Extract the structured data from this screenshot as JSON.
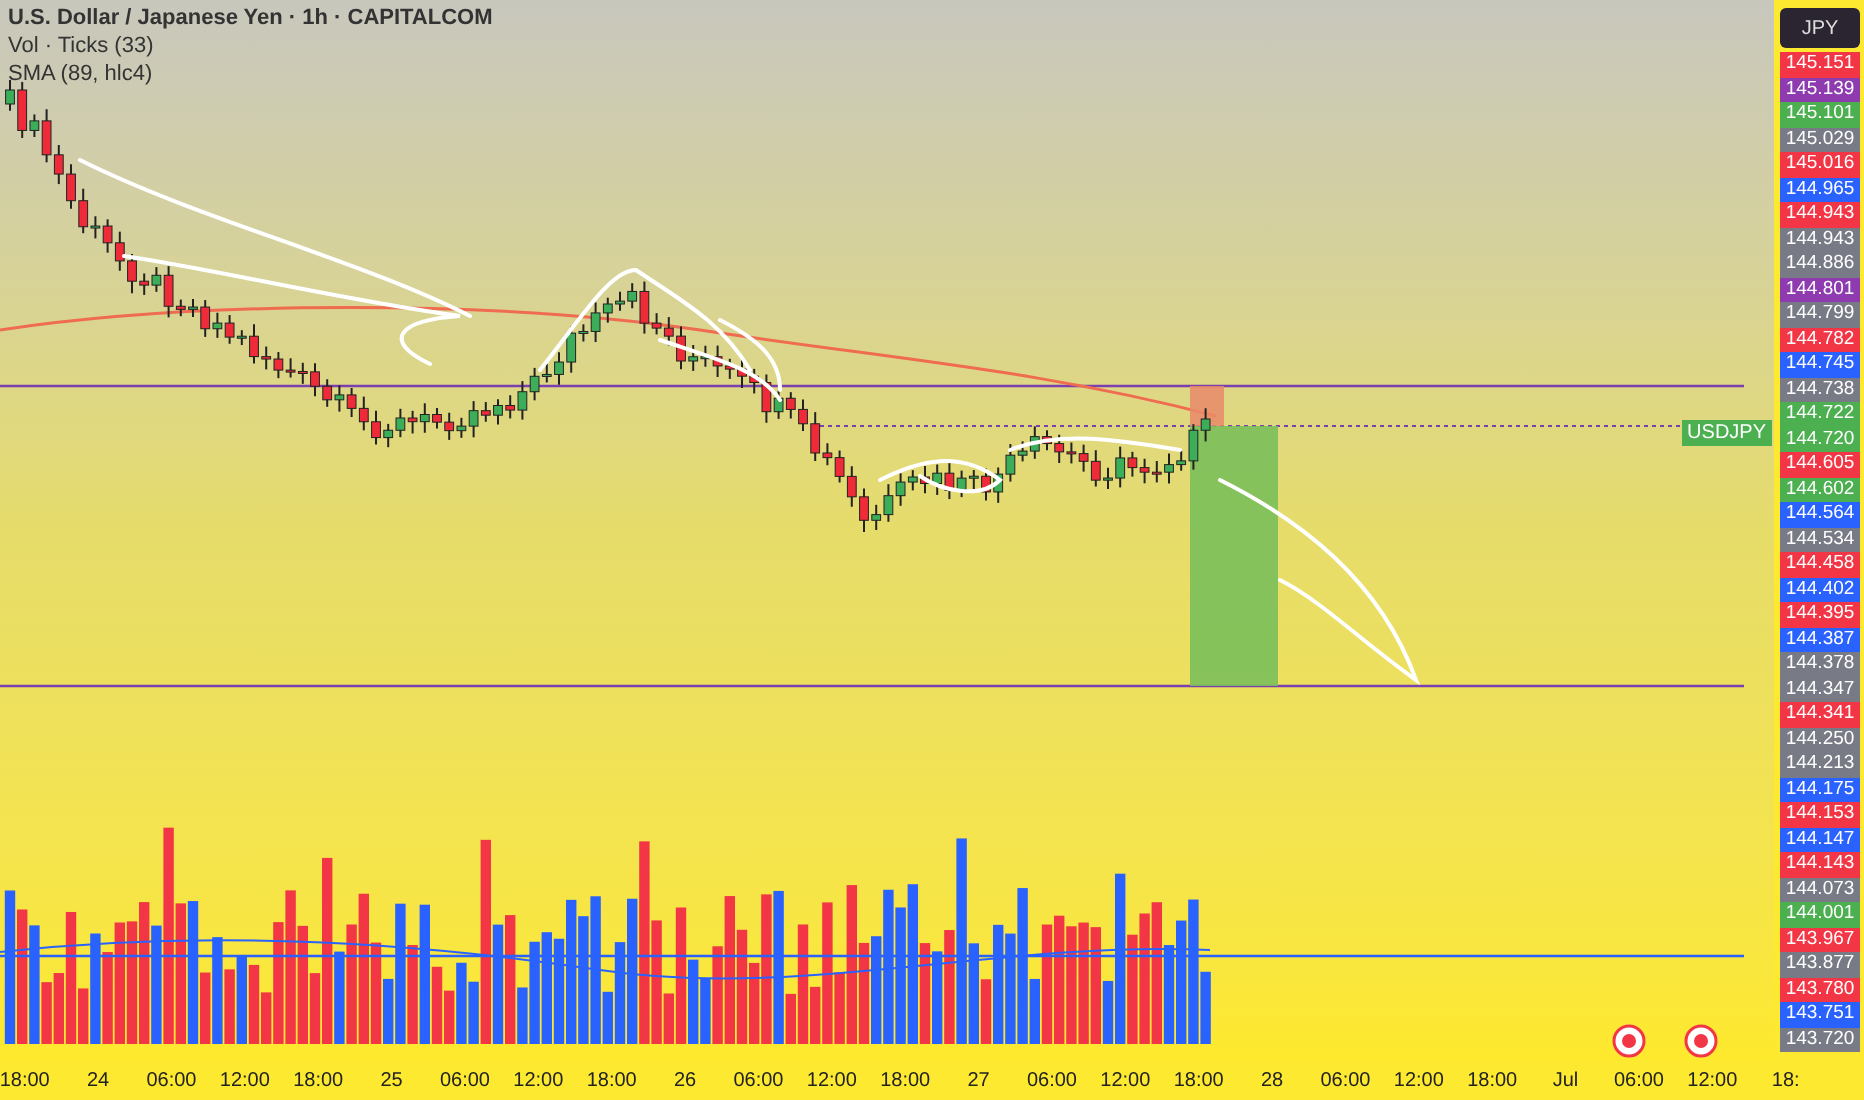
{
  "header": {
    "title": "U.S. Dollar / Japanese Yen · 1h · CAPITALCOM",
    "volume_label": "Vol · Ticks (33)",
    "sma_label": "SMA (89, hlc4)"
  },
  "currency_button": "JPY",
  "symbol_tag": "USDJPY",
  "price_labels": [
    {
      "text": "145.151",
      "color": "#f23645"
    },
    {
      "text": "145.139",
      "color": "#8e3bb0"
    },
    {
      "text": "145.101",
      "color": "#4caf50"
    },
    {
      "text": "145.029",
      "color": "#787b86"
    },
    {
      "text": "145.016",
      "color": "#f23645"
    },
    {
      "text": "144.965",
      "color": "#2962ff"
    },
    {
      "text": "144.943",
      "color": "#f23645"
    },
    {
      "text": "144.943",
      "color": "#787b86"
    },
    {
      "text": "144.886",
      "color": "#787b86"
    },
    {
      "text": "144.801",
      "color": "#8e3bb0"
    },
    {
      "text": "144.799",
      "color": "#787b86"
    },
    {
      "text": "144.782",
      "color": "#f23645"
    },
    {
      "text": "144.745",
      "color": "#2962ff"
    },
    {
      "text": "144.738",
      "color": "#787b86"
    },
    {
      "text": "144.722",
      "color": "#4caf50"
    },
    {
      "text": "144.720",
      "color": "#4caf50"
    },
    {
      "text": "144.605",
      "color": "#f23645"
    },
    {
      "text": "144.602",
      "color": "#4caf50"
    },
    {
      "text": "144.564",
      "color": "#2962ff"
    },
    {
      "text": "144.534",
      "color": "#787b86"
    },
    {
      "text": "144.458",
      "color": "#f23645"
    },
    {
      "text": "144.402",
      "color": "#2962ff"
    },
    {
      "text": "144.395",
      "color": "#f23645"
    },
    {
      "text": "144.387",
      "color": "#2962ff"
    },
    {
      "text": "144.378",
      "color": "#787b86"
    },
    {
      "text": "144.347",
      "color": "#787b86"
    },
    {
      "text": "144.341",
      "color": "#f23645"
    },
    {
      "text": "144.250",
      "color": "#787b86"
    },
    {
      "text": "144.213",
      "color": "#787b86"
    },
    {
      "text": "144.175",
      "color": "#2962ff"
    },
    {
      "text": "144.153",
      "color": "#f23645"
    },
    {
      "text": "144.147",
      "color": "#2962ff"
    },
    {
      "text": "144.143",
      "color": "#f23645"
    },
    {
      "text": "144.073",
      "color": "#787b86"
    },
    {
      "text": "144.001",
      "color": "#4caf50"
    },
    {
      "text": "143.967",
      "color": "#f23645"
    },
    {
      "text": "143.877",
      "color": "#787b86"
    },
    {
      "text": "143.780",
      "color": "#f23645"
    },
    {
      "text": "143.751",
      "color": "#2962ff"
    },
    {
      "text": "143.720",
      "color": "#787b86"
    }
  ],
  "time_labels": [
    "18:00",
    "24",
    "06:00",
    "12:00",
    "18:00",
    "25",
    "06:00",
    "12:00",
    "18:00",
    "26",
    "06:00",
    "12:00",
    "18:00",
    "27",
    "06:00",
    "12:00",
    "18:00",
    "28",
    "06:00",
    "12:00",
    "18:00",
    "Jul",
    "06:00",
    "12:00",
    "18:"
  ]
}
